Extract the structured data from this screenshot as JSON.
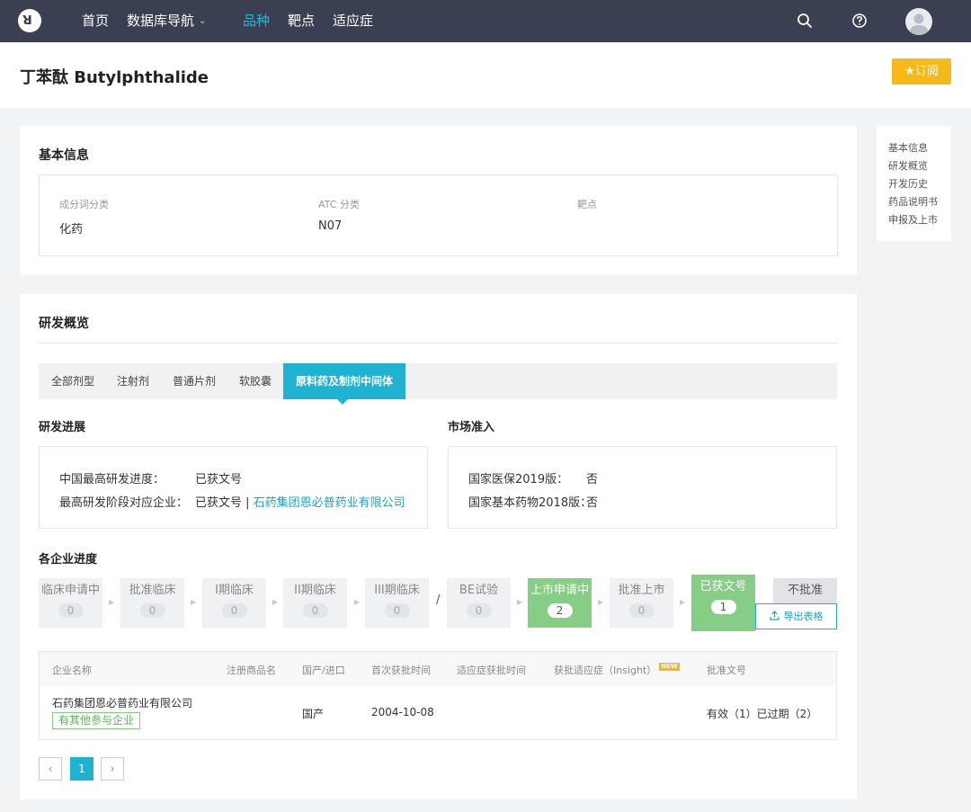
{
  "nav": {
    "items": [
      {
        "label": "首页"
      },
      {
        "label": "数据库导航"
      },
      {
        "label": "品种"
      },
      {
        "label": "靶点"
      },
      {
        "label": "适应症"
      }
    ]
  },
  "header": {
    "title": "丁苯酞 Butylphthalide",
    "subscribe_label": "订阅"
  },
  "sidenav": {
    "items": [
      "基本信息",
      "研发概览",
      "开发历史",
      "药品说明书",
      "申报及上市"
    ]
  },
  "basic_info": {
    "title": "基本信息",
    "fields": [
      {
        "label": "成分词分类",
        "value": "化药"
      },
      {
        "label": "ATC 分类",
        "value": "N07"
      },
      {
        "label": "靶点",
        "value": ""
      }
    ]
  },
  "overview": {
    "title": "研发概览",
    "tabs": [
      "全部剂型",
      "注射剂",
      "普通片剂",
      "软胶囊",
      "原料药及制剂中间体"
    ],
    "progress": {
      "title": "研发进展",
      "rows": [
        {
          "label": "中国最高研发进度：",
          "value": "已获文号"
        },
        {
          "label": "最高研发阶段对应企业：",
          "value": "已获文号 | ",
          "link": "石药集团恩必普药业有限公司"
        }
      ]
    },
    "market": {
      "title": "市场准入",
      "rows": [
        {
          "label": "国家医保2019版：",
          "value": "否"
        },
        {
          "label": "国家基本药物2018版：",
          "value": "否"
        }
      ]
    },
    "company_progress": {
      "title": "各企业进度",
      "stages": [
        {
          "name": "临床申请中",
          "count": "0"
        },
        {
          "name": "批准临床",
          "count": "0"
        },
        {
          "name": "I期临床",
          "count": "0"
        },
        {
          "name": "II期临床",
          "count": "0"
        },
        {
          "name": "III期临床",
          "count": "0"
        },
        {
          "name": "BE试验",
          "count": "0"
        },
        {
          "name": "上市申请中",
          "count": "2"
        },
        {
          "name": "批准上市",
          "count": "0"
        },
        {
          "name": "已获文号",
          "count": "1"
        },
        {
          "name": "不批准",
          "count": ""
        }
      ],
      "slash": "/",
      "export_label": "导出表格"
    },
    "table": {
      "headers": [
        "企业名称",
        "注册商品名",
        "国产/进口",
        "首次获批时间",
        "适应症获批时间",
        "获批适应症（Insight）",
        "批准文号"
      ],
      "new_badge": "NEW",
      "rows": [
        {
          "company": "石药集团恩必普药业有限公司",
          "tag": "有其他参与企业",
          "brand": "",
          "origin": "国产",
          "first_approval": "2004-10-08",
          "indication_time": "",
          "indication": "",
          "approval_no": "有效（1）已过期（2）"
        }
      ]
    },
    "pager": {
      "prev": "‹",
      "current": "1",
      "next": "›"
    }
  }
}
